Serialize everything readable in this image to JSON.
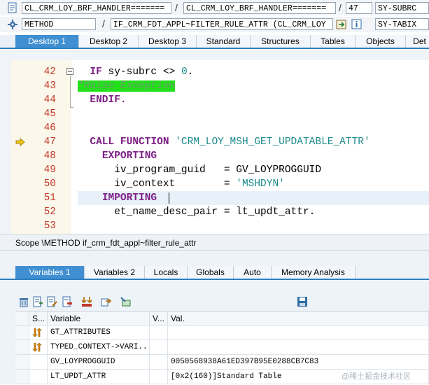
{
  "header": {
    "row1": {
      "field1": "CL_CRM_LOY_BRF_HANDLER=======",
      "field2": "CL_CRM_LOY_BRF_HANDLER=======",
      "line_number": "47",
      "sysvar": "SY-SUBRC"
    },
    "row2": {
      "kind": "METHOD",
      "method_name": "IF_CRM_FDT_APPL~FILTER_RULE_ATTR (CL_CRM_LOY",
      "sysvar": "SY-TABIX"
    }
  },
  "desktop_tabs": [
    "Desktop 1",
    "Desktop 2",
    "Desktop 3",
    "Standard",
    "Structures",
    "Tables",
    "Objects",
    "Det"
  ],
  "code": {
    "lines": [
      {
        "n": "42",
        "parts": [
          {
            "t": "  "
          },
          {
            "k": "IF"
          },
          {
            "t": " sy-subrc <> "
          },
          {
            "num": "0"
          },
          {
            "t": "."
          }
        ]
      },
      {
        "n": "43",
        "parts": [
          {
            "c": "*Raise Exception"
          }
        ]
      },
      {
        "n": "44",
        "parts": [
          {
            "t": "  "
          },
          {
            "k": "ENDIF."
          }
        ]
      },
      {
        "n": "45",
        "parts": []
      },
      {
        "n": "46",
        "parts": []
      },
      {
        "n": "47",
        "parts": [
          {
            "t": "  "
          },
          {
            "k": "CALL FUNCTION"
          },
          {
            "t": " "
          },
          {
            "s": "'CRM_LOY_MSH_GET_UPDATABLE_ATTR'"
          }
        ]
      },
      {
        "n": "48",
        "parts": [
          {
            "t": "    "
          },
          {
            "k": "EXPORTING"
          }
        ]
      },
      {
        "n": "49",
        "parts": [
          {
            "t": "      iv_program_guid   = GV_LOYPROGGUID"
          }
        ]
      },
      {
        "n": "50",
        "parts": [
          {
            "t": "      iv_context        = "
          },
          {
            "s": "'MSHDYN'"
          }
        ]
      },
      {
        "n": "51",
        "parts": [
          {
            "t": "    "
          },
          {
            "k": "IMPORTING"
          }
        ]
      },
      {
        "n": "52",
        "parts": [
          {
            "t": "      et_name_desc_pair = lt_updt_attr."
          }
        ]
      },
      {
        "n": "53",
        "parts": []
      }
    ]
  },
  "scope": "Scope \\METHOD if_crm_fdt_appl~filter_rule_attr",
  "var_tabs": [
    "Variables 1",
    "Variables 2",
    "Locals",
    "Globals",
    "Auto",
    "Memory Analysis"
  ],
  "table": {
    "headers": [
      "S...",
      "Variable",
      "V...",
      "Val."
    ],
    "rows": [
      {
        "variable": "GT_ATTRIBUTES",
        "value": ""
      },
      {
        "variable": "TYPED_CONTEXT->VARI...",
        "value": ""
      },
      {
        "variable": "GV_LOYPROGGUID",
        "value": "0050568938A61ED397B95E0288CB7C83"
      },
      {
        "variable": "LT_UPDT_ATTR",
        "value": "[0x2(160)]Standard Table"
      }
    ]
  },
  "watermark": "@稀土掘金技术社区"
}
